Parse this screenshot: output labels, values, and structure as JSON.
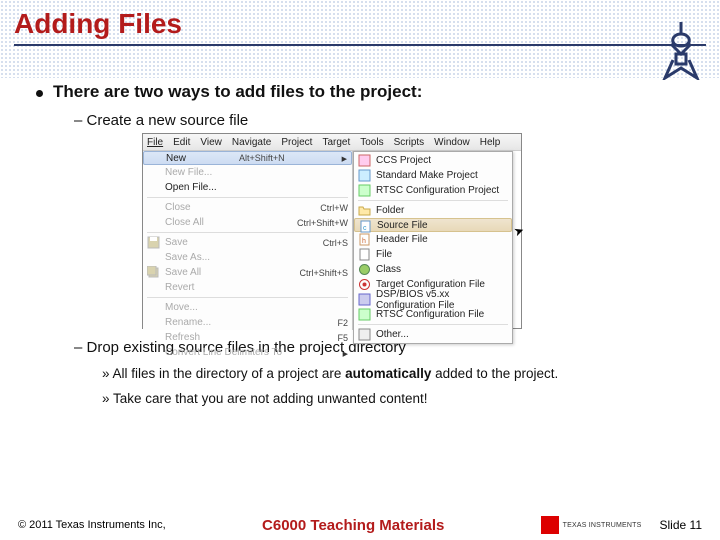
{
  "title": "Adding Files",
  "bullets": {
    "main": "There are two ways to add files to the project:",
    "sub1": "Create a new source file",
    "sub2": "Drop existing source files in the project directory",
    "sub3a_pre": "All files in the directory of a project are ",
    "sub3a_bold": "automatically",
    "sub3a_post": " added to the project.",
    "sub3b": "Take care that you are not adding unwanted content!"
  },
  "menubar": [
    "File",
    "Edit",
    "View",
    "Navigate",
    "Project",
    "Target",
    "Tools",
    "Scripts",
    "Window",
    "Help"
  ],
  "left_menu": [
    {
      "label": "New",
      "shortcut": "Alt+Shift+N",
      "highlight": true,
      "arrow": true
    },
    {
      "label": "New File...",
      "disabled": true
    },
    {
      "label": "Open File..."
    },
    {
      "sep": true
    },
    {
      "label": "Close",
      "shortcut": "Ctrl+W",
      "disabled": true
    },
    {
      "label": "Close All",
      "shortcut": "Ctrl+Shift+W",
      "disabled": true
    },
    {
      "sep": true
    },
    {
      "label": "Save",
      "shortcut": "Ctrl+S",
      "icon": "save",
      "disabled": true
    },
    {
      "label": "Save As...",
      "disabled": true
    },
    {
      "label": "Save All",
      "shortcut": "Ctrl+Shift+S",
      "icon": "saveall",
      "disabled": true
    },
    {
      "label": "Revert",
      "disabled": true
    },
    {
      "sep": true
    },
    {
      "label": "Move...",
      "disabled": true
    },
    {
      "label": "Rename...",
      "shortcut": "F2",
      "disabled": true
    },
    {
      "label": "Refresh",
      "shortcut": "F5",
      "disabled": true
    },
    {
      "label": "Convert Line Delimiters To",
      "arrow": true,
      "disabled": true
    }
  ],
  "right_menu": [
    {
      "label": "CCS Project",
      "icon": "ccs"
    },
    {
      "label": "Standard Make Project",
      "icon": "make"
    },
    {
      "label": "RTSC Configuration Project",
      "icon": "rtsc"
    },
    {
      "sep": true
    },
    {
      "label": "Folder",
      "icon": "folder"
    },
    {
      "label": "Source File",
      "icon": "cfile",
      "highlight": true
    },
    {
      "label": "Header File",
      "icon": "hfile"
    },
    {
      "label": "File",
      "icon": "file"
    },
    {
      "label": "Class",
      "icon": "class"
    },
    {
      "label": "Target Configuration File",
      "icon": "target"
    },
    {
      "label": "DSP/BIOS v5.xx Configuration File",
      "icon": "bios"
    },
    {
      "label": "RTSC Configuration File",
      "icon": "rtscf"
    },
    {
      "sep": true
    },
    {
      "label": "Other...",
      "icon": "other"
    }
  ],
  "footer": {
    "copyright": "© 2011 Texas Instruments Inc,",
    "center": "C6000 Teaching Materials",
    "tiname": "TEXAS INSTRUMENTS",
    "slide": "Slide 11"
  }
}
